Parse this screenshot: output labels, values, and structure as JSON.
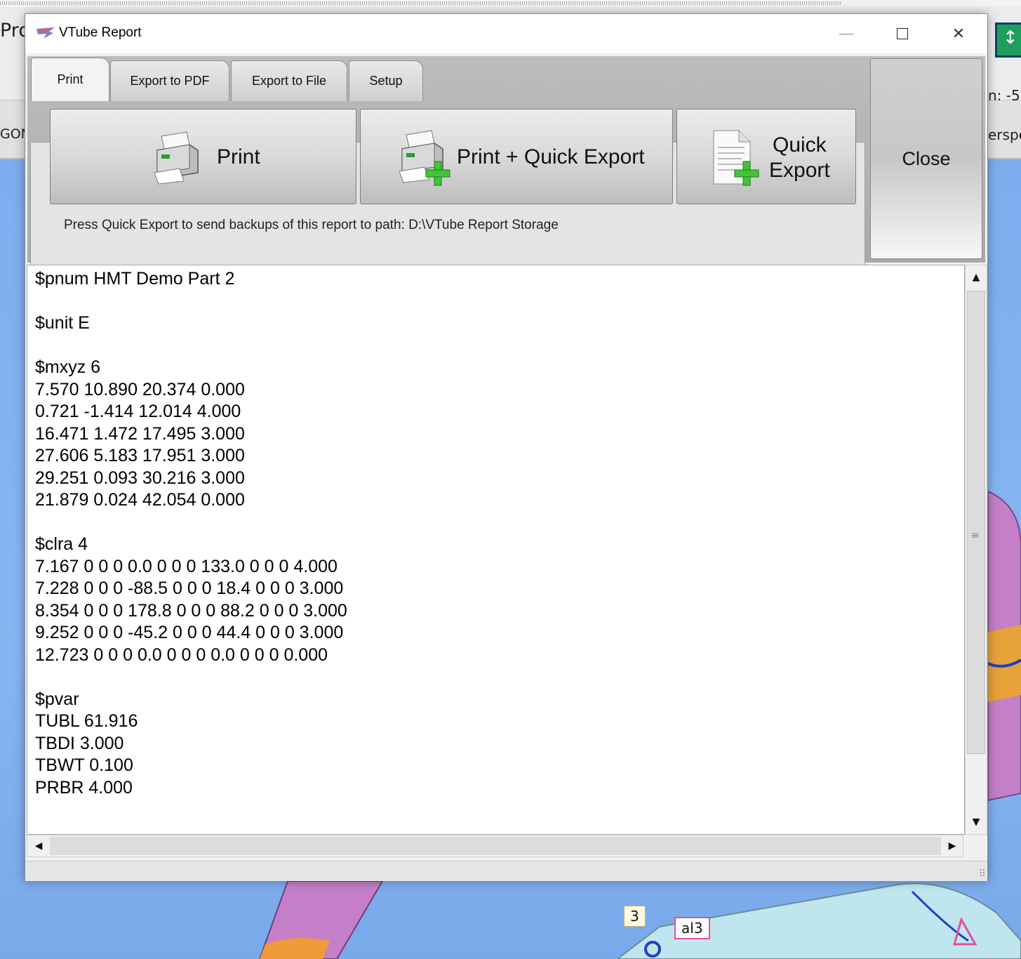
{
  "background_app": {
    "left_fragment": "Pro",
    "left_fragment2": "GON",
    "right_fragment": "n: -5",
    "right_fragment2": "erspe",
    "viewport_labels": [
      "3",
      "al3"
    ],
    "icon": "vertical-arrows-icon"
  },
  "window": {
    "title": "VTube Report",
    "app_icon": "vtube-logo-icon",
    "controls": {
      "minimize": "—",
      "maximize": "",
      "close": "✕"
    }
  },
  "tabs": [
    {
      "label": "Print",
      "active": true
    },
    {
      "label": "Export to PDF",
      "active": false
    },
    {
      "label": "Export to File",
      "active": false
    },
    {
      "label": "Setup",
      "active": false
    }
  ],
  "buttons": {
    "print": {
      "label": "Print",
      "icon": "printer-icon"
    },
    "print_quick_export": {
      "label": "Print + Quick Export",
      "icon": "printer-plus-icon"
    },
    "quick_export": {
      "label_line1": "Quick",
      "label_line2": "Export",
      "icon": "document-plus-icon"
    },
    "close": {
      "label": "Close"
    }
  },
  "info_text": "Press Quick Export to send backups of this report to path: D:\\VTube Report Storage",
  "report_lines": [
    "$pnum HMT Demo Part 2",
    "",
    "$unit E",
    "",
    "$mxyz 6",
    "7.570 10.890 20.374 0.000",
    "0.721 -1.414 12.014 4.000",
    "16.471 1.472 17.495 3.000",
    "27.606 5.183 17.951 3.000",
    "29.251 0.093 30.216 3.000",
    "21.879 0.024 42.054 0.000",
    "",
    "$clra 4",
    "7.167 0 0 0 0.0 0 0 0 133.0 0 0 0 4.000",
    "7.228 0 0 0 -88.5 0 0 0 18.4 0 0 0 3.000",
    "8.354 0 0 0 178.8 0 0 0 88.2 0 0 0 3.000",
    "9.252 0 0 0 -45.2 0 0 0 44.4 0 0 0 3.000",
    "12.723 0 0 0 0.0 0 0 0 0.0 0 0 0 0.000",
    "",
    "$pvar",
    "TUBL 61.916",
    "TBDI 3.000",
    "TBWT 0.100",
    "PRBR 4.000"
  ],
  "scrollbar": {
    "up": "▲",
    "down": "▼",
    "left": "◀",
    "right": "▶",
    "grip": "≡"
  }
}
